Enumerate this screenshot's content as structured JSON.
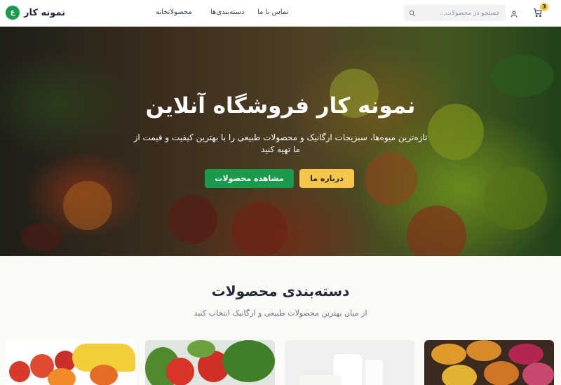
{
  "header": {
    "brand": "نمونه کار",
    "logo_letter": "ع",
    "cart_count": "3",
    "search_placeholder": "جستجو در محصولات...",
    "nav": [
      "تماس با ما",
      "دسته‌بندی‌ها",
      "محصولات",
      "خانه"
    ]
  },
  "hero": {
    "title": "نمونه کار فروشگاه آنلاین",
    "subtitle": "تازه‌ترین میوه‌ها، سبزیجات ارگانیک و محصولات طبیعی را با بهترین کیفیت و قیمت از ما تهیه کنید",
    "about_button": "درباره ما",
    "products_button": "مشاهده محصولات"
  },
  "categories": {
    "title": "دسته‌بندی محصولات",
    "subtitle": "از میان بهترین محصولات طبیعی و ارگانیک انتخاب کنید"
  },
  "icons": [
    "cart-icon",
    "user-icon",
    "search-icon"
  ],
  "colors": {
    "primary": "#1a9a4b",
    "accent": "#f5c64a"
  }
}
